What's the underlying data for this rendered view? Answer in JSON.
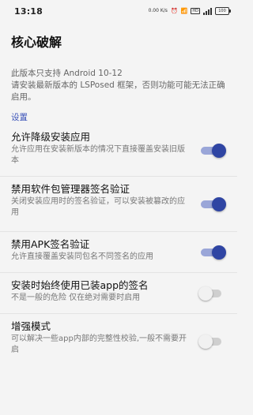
{
  "status_bar": {
    "time": "13:18",
    "speed": "0.00 K/s",
    "network": "HD",
    "battery": "100"
  },
  "app_bar": {
    "title": "核心破解"
  },
  "notice": {
    "line1": "此版本只支持 Android 10-12",
    "line2": "请安装最新版本的 LSPosed 框架，否则功能可能无法正确启用。"
  },
  "section": {
    "title": "设置"
  },
  "settings": [
    {
      "title": "允许降级安装应用",
      "summary": "允许应用在安装新版本的情况下直接覆盖安装旧版本",
      "enabled": true
    },
    {
      "title": "禁用软件包管理器签名验证",
      "summary": "关闭安装应用时的签名验证，可以安装被篡改的应用",
      "enabled": true
    },
    {
      "title": "禁用APK签名验证",
      "summary": "允许直接覆盖安装同包名不同签名的应用",
      "enabled": true
    },
    {
      "title": "安装时始终使用已装app的签名",
      "summary": "不是一般的危险 仅在绝对需要时启用",
      "enabled": false
    },
    {
      "title": "增强模式",
      "summary": "可以解决一些app内部的完整性校验,一般不需要开启",
      "enabled": false
    }
  ],
  "colors": {
    "accent": "#2f45a3",
    "section_title": "#3a52b8"
  }
}
